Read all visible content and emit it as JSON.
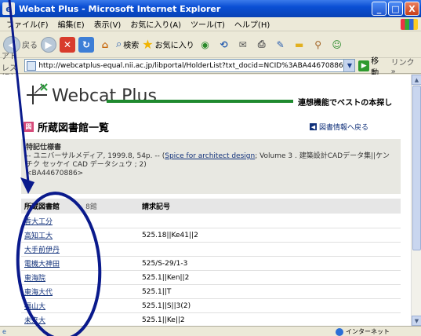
{
  "window": {
    "title": "Webcat Plus - Microsoft Internet Explorer",
    "controls": [
      "_",
      "□",
      "X"
    ]
  },
  "menu": [
    "ファイル(F)",
    "編集(E)",
    "表示(V)",
    "お気に入り(A)",
    "ツール(T)",
    "ヘルプ(H)"
  ],
  "toolbar": {
    "back_label": "戻る",
    "search_label": "検索",
    "favorites_label": "お気に入り"
  },
  "address": {
    "label": "アドレス(D)",
    "url": "http://webcatplus-equal.nii.ac.jp/libportal/HolderList?txt_docid=NCID%3ABA44670886",
    "go_label": "移動",
    "links_label": "リンク »"
  },
  "header": {
    "brand": "Webcat Plus",
    "tagline": "連想機能でベストの本探し"
  },
  "page": {
    "title": "所蔵図書館一覧",
    "back_link": "図書情報へ戻る"
  },
  "book": {
    "title": "特記仕様書",
    "info_prefix": "-- ユニバーサルメディア, 1999.8, 54p. -- (",
    "series_link": "Spice for architect design",
    "info_suffix": "; Volume 3 . 建築設計CADデータ集||ケンチク セッケイ CAD データシュウ ; 2)",
    "id": "<BA44670886>"
  },
  "holdings": {
    "header_library": "所蔵図書館",
    "count": "8館",
    "header_callno": "請求記号",
    "rows": [
      {
        "library": "香大工分",
        "callno": ""
      },
      {
        "library": "高知工大",
        "callno": "525.18||Ke41||2"
      },
      {
        "library": "大手前伊丹",
        "callno": ""
      },
      {
        "library": "電機大神田",
        "callno": "525/S-29/1-3"
      },
      {
        "library": "東海院",
        "callno": "525.1||Ken||2"
      },
      {
        "library": "東海大代",
        "callno": "525.1||T"
      },
      {
        "library": "福山大",
        "callno": "525.1||S||3(2)"
      },
      {
        "library": "未来大",
        "callno": "525.1||Ke||2"
      }
    ]
  },
  "status": {
    "zone": "インターネット"
  },
  "colors": {
    "annotation": "#0a1a8c",
    "link": "#10307a",
    "tagline_bar": "#1f8a2f"
  }
}
